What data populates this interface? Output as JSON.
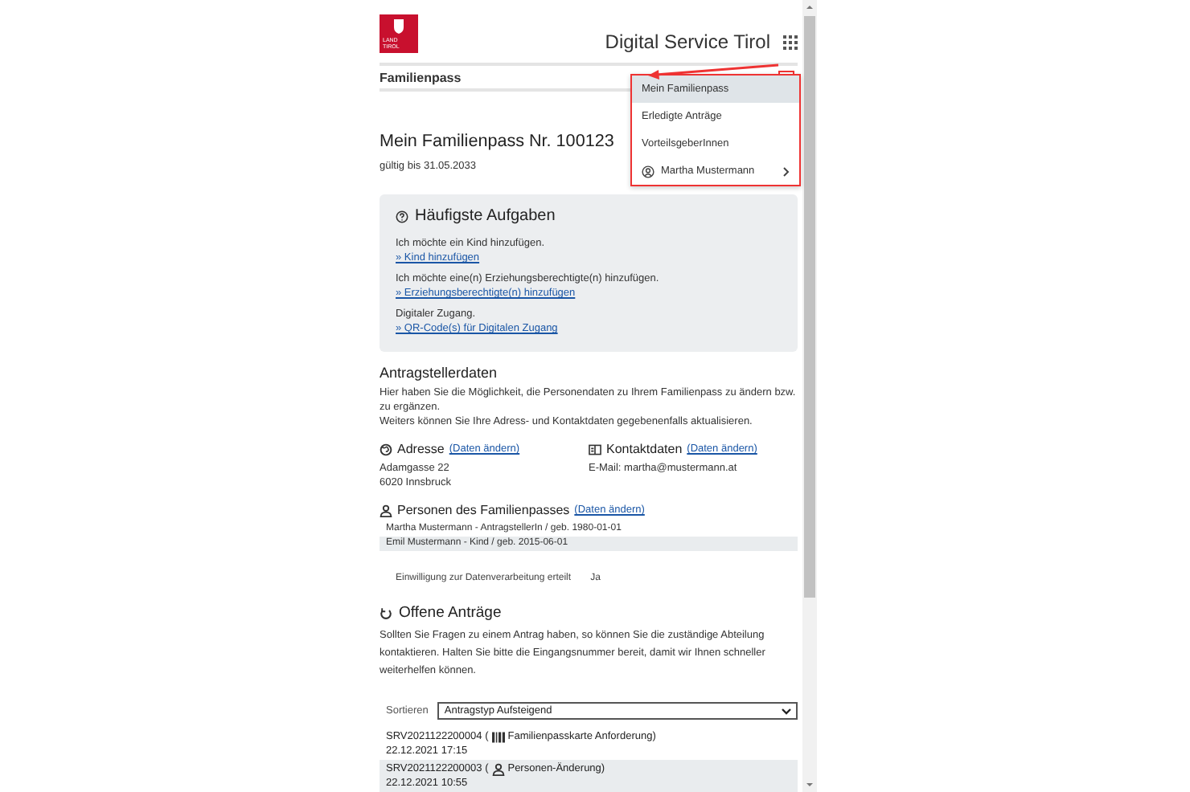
{
  "header": {
    "logo_lines": [
      "LAND",
      "TIROL"
    ],
    "service_title": "Digital Service Tirol"
  },
  "nav": {
    "title": "Familienpass"
  },
  "menu": {
    "items": [
      {
        "label": "Mein Familienpass",
        "selected": true,
        "kind": "link"
      },
      {
        "label": "Erledigte Anträge",
        "selected": false,
        "kind": "link"
      },
      {
        "label": "VorteilsgeberInnen",
        "selected": false,
        "kind": "link"
      },
      {
        "label": "Martha Mustermann",
        "selected": false,
        "kind": "user"
      }
    ]
  },
  "pass": {
    "title": "Mein Familienpass Nr. 100123",
    "validity": "gültig bis 31.05.2033"
  },
  "tasks": {
    "title": "Häufigste Aufgaben",
    "items": [
      {
        "text": "Ich möchte ein Kind hinzufügen.",
        "link": "» Kind hinzufügen"
      },
      {
        "text": "Ich möchte eine(n) Erziehungsberechtigte(n) hinzufügen.",
        "link": "» Erziehungsberechtigte(n) hinzufügen"
      },
      {
        "text": "Digitaler Zugang.",
        "link": "» QR-Code(s) für Digitalen Zugang"
      }
    ]
  },
  "applicant": {
    "title": "Antragstellerdaten",
    "paragraphs": [
      "Hier haben Sie die Möglichkeit, die Personendaten zu Ihrem Familienpass zu ändern bzw. zu ergänzen.",
      "Weiters können Sie Ihre Adress- und Kontaktdaten gegebenenfalls aktualisieren."
    ],
    "address": {
      "title": "Adresse",
      "link": "(Daten ändern)",
      "lines": [
        "Adamgasse 22",
        "6020 Innsbruck"
      ]
    },
    "contact": {
      "title": "Kontaktdaten",
      "link": "(Daten ändern)",
      "lines": [
        "E-Mail: martha@mustermann.at"
      ]
    },
    "persons": {
      "title": "Personen des Familienpasses",
      "link": "(Daten ändern)",
      "rows": [
        "Martha Mustermann - AntragstellerIn / geb. 1980-01-01",
        "Emil Mustermann - Kind / geb. 2015-06-01"
      ]
    },
    "consent": {
      "label": "Einwilligung zur Datenverarbeitung erteilt",
      "value": "Ja"
    }
  },
  "open_requests": {
    "title": "Offene Anträge",
    "description": "Sollten Sie Fragen zu einem Antrag haben, so können Sie die zuständige Abteilung kontaktieren. Halten Sie bitte die Eingangsnummer bereit, damit wir Ihnen schneller weiterhelfen können.",
    "sort_label": "Sortieren",
    "sort_value": "Antragstyp Aufsteigend",
    "requests": [
      {
        "number": "SRV2021122200004 (",
        "kind": "card",
        "type": "Familienpasskarte Anforderung)",
        "date": "22.12.2021 17:15"
      },
      {
        "number": "SRV2021122200003 (",
        "kind": "person",
        "type": "Personen-Änderung)",
        "date": "22.12.2021 10:55"
      }
    ]
  }
}
